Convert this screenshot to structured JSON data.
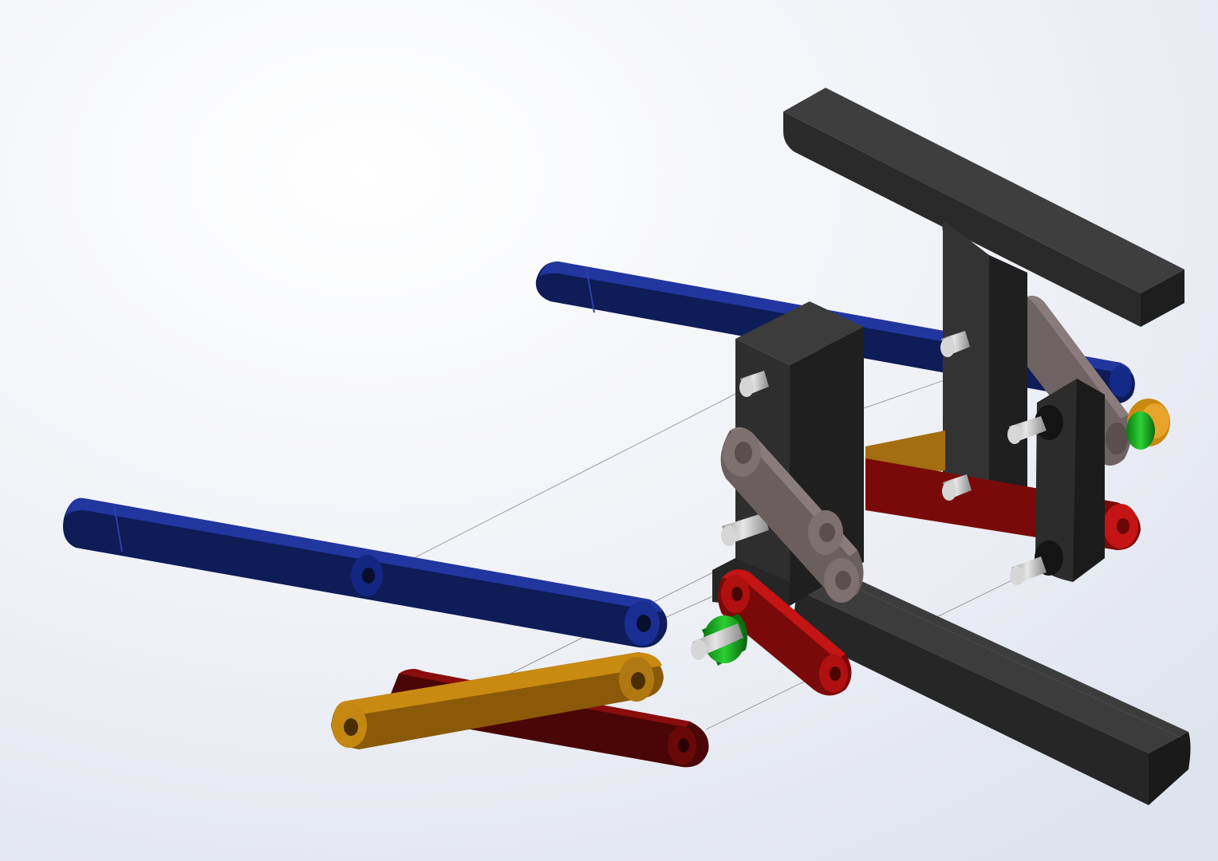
{
  "scene": {
    "description_visible_text": "",
    "background": {
      "top": "#ffffff",
      "bottom": "#e9ecf3",
      "accent": "#dde2ee"
    },
    "palette": {
      "frame": "#3a3a3a",
      "frame_side": "#232323",
      "frame_dark": "#1a1a1a",
      "blue": "#0f1f5c",
      "blue_light": "#1c3199",
      "blue_dark": "#0a1542",
      "orange": "#8a5a08",
      "orange_light": "#c98a12",
      "orange_dark": "#5a3a04",
      "dark_red": "#4a0606",
      "red": "#7a0a0a",
      "red_light": "#c41414",
      "grey_link": "#6e6262",
      "grey_link_light": "#8a7c7c",
      "green": "#15a51e",
      "green_dark": "#0b6c12",
      "pin": "#b8b8b8",
      "pin_light": "#e4e4e4",
      "pin_dark": "#808080",
      "explode_line": "#8a8a8a"
    }
  }
}
